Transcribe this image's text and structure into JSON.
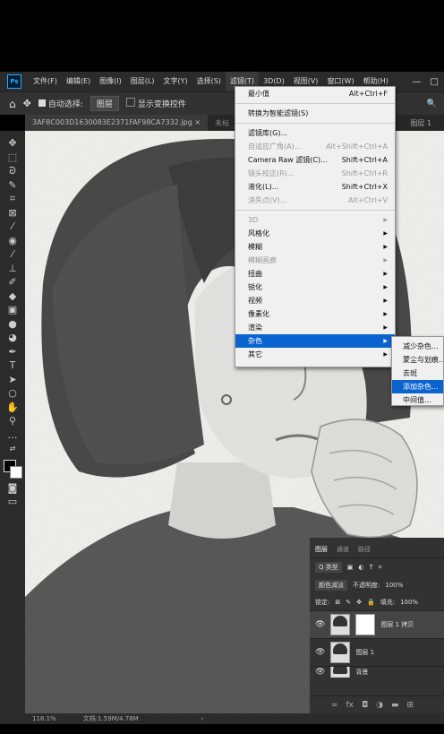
{
  "menubar": {
    "logo": "Ps",
    "items": [
      "文件(F)",
      "编辑(E)",
      "图像(I)",
      "图层(L)",
      "文字(Y)",
      "选择(S)",
      "滤镜(T)",
      "3D(D)",
      "视图(V)",
      "窗口(W)",
      "帮助(H)"
    ],
    "window_buttons": [
      "—",
      "□"
    ]
  },
  "optionsbar": {
    "home_icon": "⌂",
    "move_icon": "✥",
    "auto_select_label": "自动选择:",
    "auto_select_value": "图层",
    "show_transform_label": "显示变换控件",
    "search_icon": "🔍"
  },
  "tabbar": {
    "doc_tab": "3AF8C003D1630083E2371FAF98CA7332.jpg ×",
    "second_tab": "未标",
    "right_text": "图层 1"
  },
  "filter_menu": {
    "items": [
      {
        "label": "最小值",
        "shortcut": "Alt+Ctrl+F",
        "disabled": false
      },
      {
        "sep": true
      },
      {
        "label": "转换为智能滤镜(S)",
        "shortcut": "",
        "disabled": false
      },
      {
        "sep": true
      },
      {
        "label": "滤镜库(G)...",
        "shortcut": "",
        "disabled": false
      },
      {
        "label": "自适应广角(A)...",
        "shortcut": "Alt+Shift+Ctrl+A",
        "disabled": true
      },
      {
        "label": "Camera Raw 滤镜(C)...",
        "shortcut": "Shift+Ctrl+A",
        "disabled": false
      },
      {
        "label": "镜头校正(R)...",
        "shortcut": "Shift+Ctrl+R",
        "disabled": true
      },
      {
        "label": "液化(L)...",
        "shortcut": "Shift+Ctrl+X",
        "disabled": false
      },
      {
        "label": "消失点(V)...",
        "shortcut": "Alt+Ctrl+V",
        "disabled": true
      },
      {
        "sep": true
      },
      {
        "label": "3D",
        "submenu": true,
        "disabled": true
      },
      {
        "label": "风格化",
        "submenu": true,
        "disabled": false
      },
      {
        "label": "模糊",
        "submenu": true,
        "disabled": false
      },
      {
        "label": "模糊画廊",
        "submenu": true,
        "disabled": true
      },
      {
        "label": "扭曲",
        "submenu": true,
        "disabled": false
      },
      {
        "label": "锐化",
        "submenu": true,
        "disabled": false
      },
      {
        "label": "视频",
        "submenu": true,
        "disabled": false
      },
      {
        "label": "像素化",
        "submenu": true,
        "disabled": false
      },
      {
        "label": "渲染",
        "submenu": true,
        "disabled": false
      },
      {
        "label": "杂色",
        "submenu": true,
        "disabled": false,
        "highlight": true
      },
      {
        "label": "其它",
        "submenu": true,
        "disabled": false
      }
    ]
  },
  "noise_submenu": {
    "items": [
      "减少杂色...",
      "蒙尘与划痕...",
      "去斑",
      "添加杂色...",
      "中间值..."
    ],
    "highlighted_index": 3
  },
  "layers_panel": {
    "tabs": [
      "图层",
      "通道",
      "路径"
    ],
    "kind_label": "Q 类型",
    "blend_mode": "颜色减淡",
    "opacity_label": "不透明度:",
    "opacity_value": "100%",
    "lock_label": "锁定:",
    "fill_label": "填充:",
    "fill_value": "100%",
    "layers": [
      {
        "name": "图层 1 拷贝",
        "selected": true,
        "has_mask": true
      },
      {
        "name": "图层 1",
        "selected": false,
        "has_mask": false
      },
      {
        "name": "背景",
        "selected": false,
        "has_mask": false
      }
    ]
  },
  "statusbar": {
    "zoom": "118.1%",
    "doc_info": "文档:1.59M/4.78M",
    "arrow": "›"
  }
}
